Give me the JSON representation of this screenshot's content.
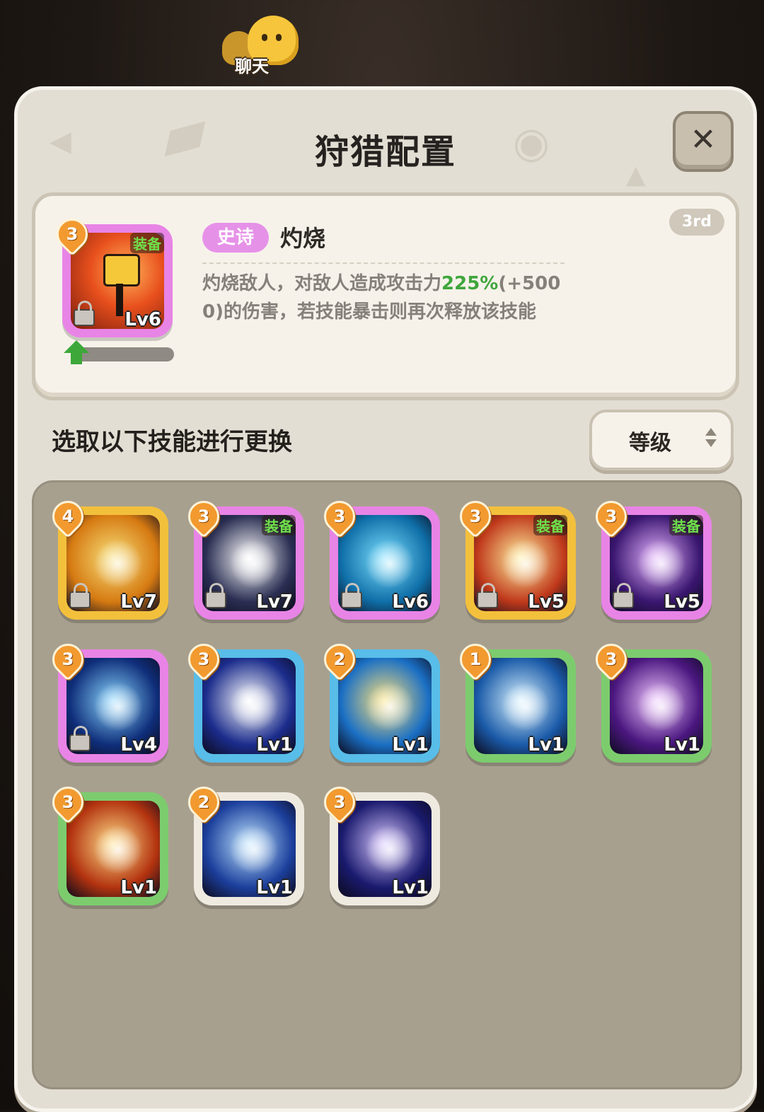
{
  "chat": {
    "label": "聊天",
    "icon": "chat-bubble-icon"
  },
  "window": {
    "title": "狩猎配置",
    "close_label": "✕"
  },
  "detail": {
    "rank": "3rd",
    "grade": "史诗",
    "name": "灼烧",
    "desc_part1": "灼烧敌人，对敌人造成攻击力",
    "desc_highlight": "225%",
    "desc_part2": "(+500",
    "desc_part3": "0)的伤害，若技能暴击则再次释放该技能",
    "icon": {
      "count": "3",
      "equip_label": "装备",
      "level": "Lv6",
      "locked": true,
      "rarity": "epic",
      "art": "flame-figure"
    },
    "upgrade_progress": 0.0
  },
  "list": {
    "subtitle": "选取以下技能进行更换",
    "sort_label": "等级"
  },
  "skills": [
    {
      "count": "4",
      "level": "Lv7",
      "rarity": "gold",
      "equipped": false,
      "locked": true,
      "art": "fire-orb",
      "colors": [
        "#f7e07a",
        "#d67a12"
      ]
    },
    {
      "count": "3",
      "level": "Lv7",
      "rarity": "pink",
      "equipped": true,
      "locked": true,
      "art": "star-seal",
      "colors": [
        "#ffffff",
        "#2a2e52"
      ]
    },
    {
      "count": "3",
      "level": "Lv6",
      "rarity": "pink",
      "equipped": false,
      "locked": true,
      "art": "blue-cube",
      "colors": [
        "#7de0ff",
        "#0f6fa8"
      ]
    },
    {
      "count": "3",
      "level": "Lv5",
      "rarity": "gold",
      "equipped": true,
      "locked": true,
      "art": "fire-burst",
      "colors": [
        "#fff1a0",
        "#c0391b"
      ]
    },
    {
      "count": "3",
      "level": "Lv5",
      "rarity": "pink",
      "equipped": true,
      "locked": true,
      "art": "purple-lightning",
      "colors": [
        "#e6b4ff",
        "#3a1670"
      ]
    },
    {
      "count": "3",
      "level": "Lv4",
      "rarity": "pink",
      "equipped": false,
      "locked": true,
      "art": "blue-vortex",
      "colors": [
        "#8ad7ff",
        "#0f2e7a"
      ]
    },
    {
      "count": "3",
      "level": "Lv1",
      "rarity": "blue",
      "equipped": false,
      "locked": false,
      "art": "comet",
      "colors": [
        "#ffffff",
        "#1b2c8c"
      ]
    },
    {
      "count": "2",
      "level": "Lv1",
      "rarity": "blue",
      "equipped": false,
      "locked": false,
      "art": "twin-figures",
      "colors": [
        "#ffe27a",
        "#1a6fc4"
      ]
    },
    {
      "count": "1",
      "level": "Lv1",
      "rarity": "green",
      "equipped": false,
      "locked": false,
      "art": "ice-shards",
      "colors": [
        "#d8f3ff",
        "#1a5aa8"
      ]
    },
    {
      "count": "3",
      "level": "Lv1",
      "rarity": "green",
      "equipped": false,
      "locked": false,
      "art": "purple-orb",
      "colors": [
        "#f0c6ff",
        "#4b1780"
      ]
    },
    {
      "count": "3",
      "level": "Lv1",
      "rarity": "green",
      "equipped": false,
      "locked": false,
      "art": "fireball",
      "colors": [
        "#ffe08a",
        "#b3330f"
      ]
    },
    {
      "count": "2",
      "level": "Lv1",
      "rarity": "white",
      "equipped": false,
      "locked": false,
      "art": "blue-slash",
      "colors": [
        "#bfe6ff",
        "#1c3f9c"
      ]
    },
    {
      "count": "3",
      "level": "Lv1",
      "rarity": "white",
      "equipped": false,
      "locked": false,
      "art": "violet-spikes",
      "colors": [
        "#d9c8ff",
        "#1a1a6e"
      ]
    }
  ],
  "equip_label": "装备"
}
